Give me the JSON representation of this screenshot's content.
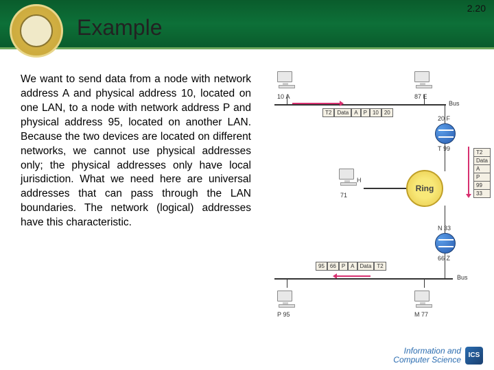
{
  "page_number": "2.20",
  "title": "Example",
  "body_text": "We want to send data from a node with network address A and physical address 10, located on one LAN, to a node with network address P and physical address 95, located on another LAN. Because the two devices are located on different networks, we cannot use physical addresses only; the physical addresses only have local jurisdiction. What we need here are universal addresses that can pass through the LAN boundaries. The network (logical) addresses have this characteristic.",
  "diagram": {
    "bus_top_label": "Bus",
    "bus_bottom_label": "Bus",
    "ring_label": "Ring",
    "nodes": {
      "n10A": {
        "phys": "10",
        "net": "A"
      },
      "n87E": {
        "phys": "87",
        "net": "E"
      },
      "n20F": {
        "phys": "20",
        "net": "F"
      },
      "nT99": {
        "net": "T",
        "phys": "99"
      },
      "nH71": {
        "net": "H",
        "phys": "71"
      },
      "nN33": {
        "net": "N",
        "phys": "33"
      },
      "n66Z": {
        "phys": "66",
        "net": "Z"
      },
      "nP95": {
        "net": "P",
        "phys": "95"
      },
      "nM77": {
        "net": "M",
        "phys": "77"
      }
    },
    "packets": {
      "p1": {
        "f1": "T2",
        "f2": "Data",
        "f3": "A",
        "f4": "P",
        "f5": "10",
        "f6": "20"
      },
      "p2": {
        "f1": "T2",
        "f2": "Data",
        "f3": "A",
        "f4": "P",
        "f5": "99",
        "f6": "33"
      },
      "p3": {
        "f1": "95",
        "f2": "66",
        "f3": "P",
        "f4": "A",
        "f5": "Data",
        "f6": "T2"
      }
    }
  },
  "footer": {
    "line1": "Information and",
    "line2": "Computer Science",
    "badge": "ICS"
  }
}
